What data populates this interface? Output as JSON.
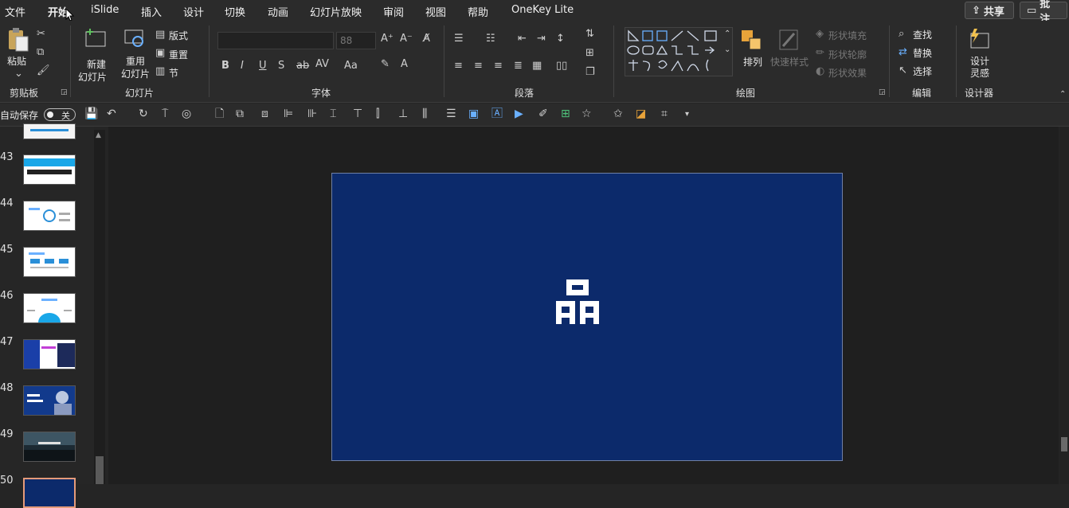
{
  "tabs": [
    "文件",
    "开始",
    "iSlide",
    "插入",
    "设计",
    "切换",
    "动画",
    "幻灯片放映",
    "审阅",
    "视图",
    "帮助",
    "OneKey Lite"
  ],
  "active_tab": "开始",
  "header_buttons": {
    "share": "共享",
    "comments": "批注"
  },
  "ribbon": {
    "clipboard": {
      "paste": "粘贴",
      "group": "剪贴板"
    },
    "slides": {
      "new_line1": "新建",
      "new_line2": "幻灯片",
      "reuse_line1": "重用",
      "reuse_line2": "幻灯片",
      "layout": "版式",
      "reset": "重置",
      "section": "节",
      "group": "幻灯片"
    },
    "font": {
      "font_size": "88",
      "group": "字体"
    },
    "paragraph": {
      "group": "段落"
    },
    "drawing": {
      "arrange": "排列",
      "quick_styles": "快速样式",
      "shape_fill": "形状填充",
      "shape_outline": "形状轮廓",
      "shape_effects": "形状效果",
      "group": "绘图"
    },
    "editing": {
      "find": "查找",
      "replace": "替换",
      "select": "选择",
      "group": "编辑"
    },
    "designer": {
      "line1": "设计",
      "line2": "灵感",
      "group": "设计器"
    }
  },
  "autosave": {
    "label": "自动保存",
    "state": "关"
  },
  "thumbnails": [
    {
      "num": "43",
      "style": "blue-header"
    },
    {
      "num": "44",
      "style": "white-diagram"
    },
    {
      "num": "45",
      "style": "white-flow"
    },
    {
      "num": "46",
      "style": "white-arc"
    },
    {
      "num": "47",
      "style": "blue-photo"
    },
    {
      "num": "48",
      "style": "navy-person"
    },
    {
      "num": "49",
      "style": "dark-landscape"
    },
    {
      "num": "50",
      "style": "current"
    }
  ],
  "slide": {
    "logo_glyph": "品",
    "background": "#0c2a6b"
  },
  "colors": {
    "ribbon_bg": "#2b2b2b",
    "canvas_bg": "#1f1f1f",
    "save_icon": "#c23fd6",
    "accent_orange": "#e8a33a"
  }
}
